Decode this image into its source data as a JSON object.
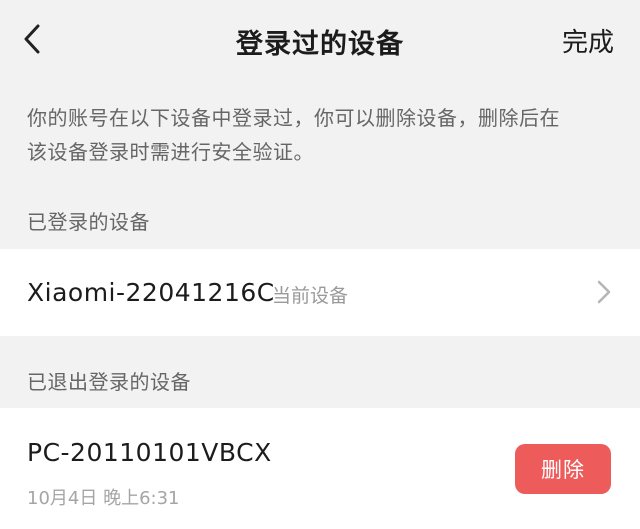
{
  "header": {
    "back_icon": "chevron-left-icon",
    "title": "登录过的设备",
    "done_label": "完成"
  },
  "description": {
    "line1": "你的账号在以下设备中登录过，你可以删除设备，删除后在",
    "line2": "该设备登录时需进行安全验证。"
  },
  "logged_in_section": {
    "label": "已登录的设备",
    "devices": [
      {
        "name": "Xiaomi-22041216C",
        "tag": "当前设备",
        "icon": "chevron-right-icon"
      }
    ]
  },
  "logged_out_section": {
    "label": "已退出登录的设备",
    "devices": [
      {
        "name": "PC-20110101VBCX",
        "time": "10月4日 晚上6:31",
        "delete_label": "删除"
      }
    ]
  },
  "colors": {
    "background": "#f2f2f2",
    "card": "#ffffff",
    "delete_button": "#ee5b5b",
    "secondary_text": "#666666"
  }
}
